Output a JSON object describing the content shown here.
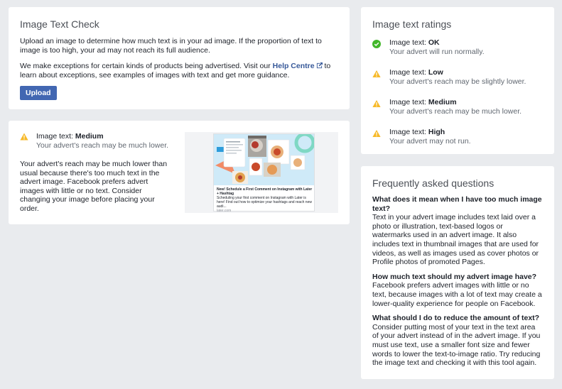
{
  "check": {
    "title": "Image Text Check",
    "para1": "Upload an image to determine how much text is in your ad image. If the proportion of text to image is too high, your ad may not reach its full audience.",
    "para2_before": "We make exceptions for certain kinds of products being advertised. Visit our ",
    "help_link": "Help Centre",
    "para2_after": " to learn about exceptions, see examples of images with text and get more guidance.",
    "upload_label": "Upload"
  },
  "result": {
    "label_prefix": "Image text: ",
    "level": "Medium",
    "subline": "Your advert's reach may be much lower.",
    "body": "Your advert's reach may be much lower than usual because there's too much text in the advert image. Facebook prefers advert images with little or no text. Consider changing your image before placing your order.",
    "preview": {
      "caption_title": "New! Schedule a First Comment on Instagram with Later + Hashtag",
      "caption_desc": "Scheduling your first comment on Instagram with Later is here! Find out how to optimize your hashtags and reach new audi...",
      "caption_url": "later.com"
    }
  },
  "ratings": {
    "title": "Image text ratings",
    "items": [
      {
        "prefix": "Image text: ",
        "level": "OK",
        "desc": "Your advert will run normally.",
        "icon": "check-circle-icon",
        "color": "#42b72a"
      },
      {
        "prefix": "Image text: ",
        "level": "Low",
        "desc": "Your advert's reach may be slightly lower.",
        "icon": "warning-icon",
        "color": "#f7b928"
      },
      {
        "prefix": "Image text: ",
        "level": "Medium",
        "desc": "Your advert's reach may be much lower.",
        "icon": "warning-icon",
        "color": "#f7b928"
      },
      {
        "prefix": "Image text: ",
        "level": "High",
        "desc": "Your advert may not run.",
        "icon": "warning-icon",
        "color": "#f7b928"
      }
    ]
  },
  "faq": {
    "title": "Frequently asked questions",
    "items": [
      {
        "q": "What does it mean when I have too much image text?",
        "a": "Text in your advert image includes text laid over a photo or illustration, text-based logos or watermarks used in an advert image. It also includes text in thumbnail images that are used for videos, as well as images used as cover photos or Profile photos of promoted Pages."
      },
      {
        "q": "How much text should my advert image have?",
        "a": "Facebook prefers advert images with little or no text, because images with a lot of text may create a lower-quality experience for people on Facebook."
      },
      {
        "q": "What should I do to reduce the amount of text?",
        "a": "Consider putting most of your text in the text area of your advert instead of in the advert image. If you must use text, use a smaller font size and fewer words to lower the text-to-image ratio. Try reducing the image text and checking it with this tool again."
      }
    ]
  },
  "colors": {
    "accent": "#4267b2",
    "link": "#365899",
    "warning": "#f7b928",
    "ok": "#42b72a",
    "background": "#e9ebee"
  }
}
